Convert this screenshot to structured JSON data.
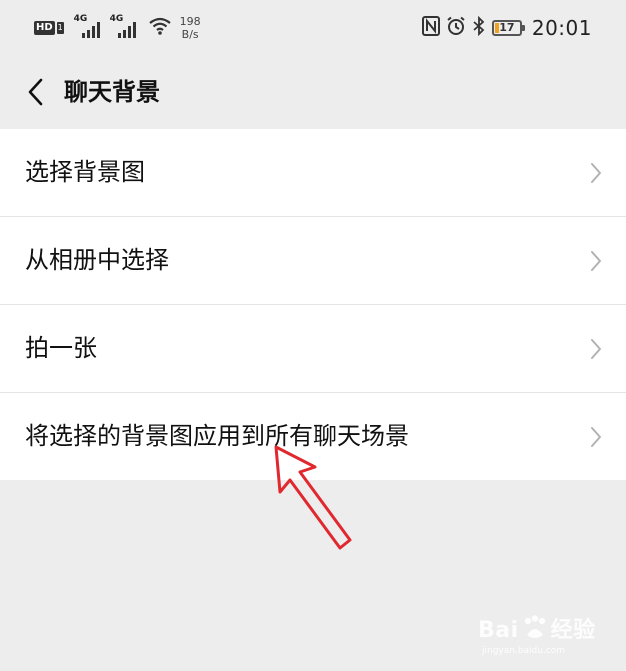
{
  "status_bar": {
    "hd_badge": "HD",
    "sim_number": "1",
    "network_1": "4G",
    "network_2": "4G",
    "speed_value": "198",
    "speed_unit": "B/s",
    "battery_level": "17",
    "time": "20:01",
    "icons": [
      "nfc-icon",
      "alarm-icon",
      "bluetooth-icon",
      "battery-icon"
    ]
  },
  "nav": {
    "back_icon": "chevron-left-icon",
    "title": "聊天背景"
  },
  "menu": {
    "items": [
      {
        "label": "选择背景图"
      },
      {
        "label": "从相册中选择"
      },
      {
        "label": "拍一张"
      },
      {
        "label": "将选择的背景图应用到所有聊天场景"
      }
    ]
  },
  "annotation": {
    "arrow_color": "#e0282f"
  },
  "watermark": {
    "brand": "Bai",
    "brand_suffix": "经验",
    "sub": "jingyan.baidu.com"
  },
  "colors": {
    "background": "#ededed",
    "list_background": "#ffffff",
    "battery_fill": "#f0a21b"
  }
}
